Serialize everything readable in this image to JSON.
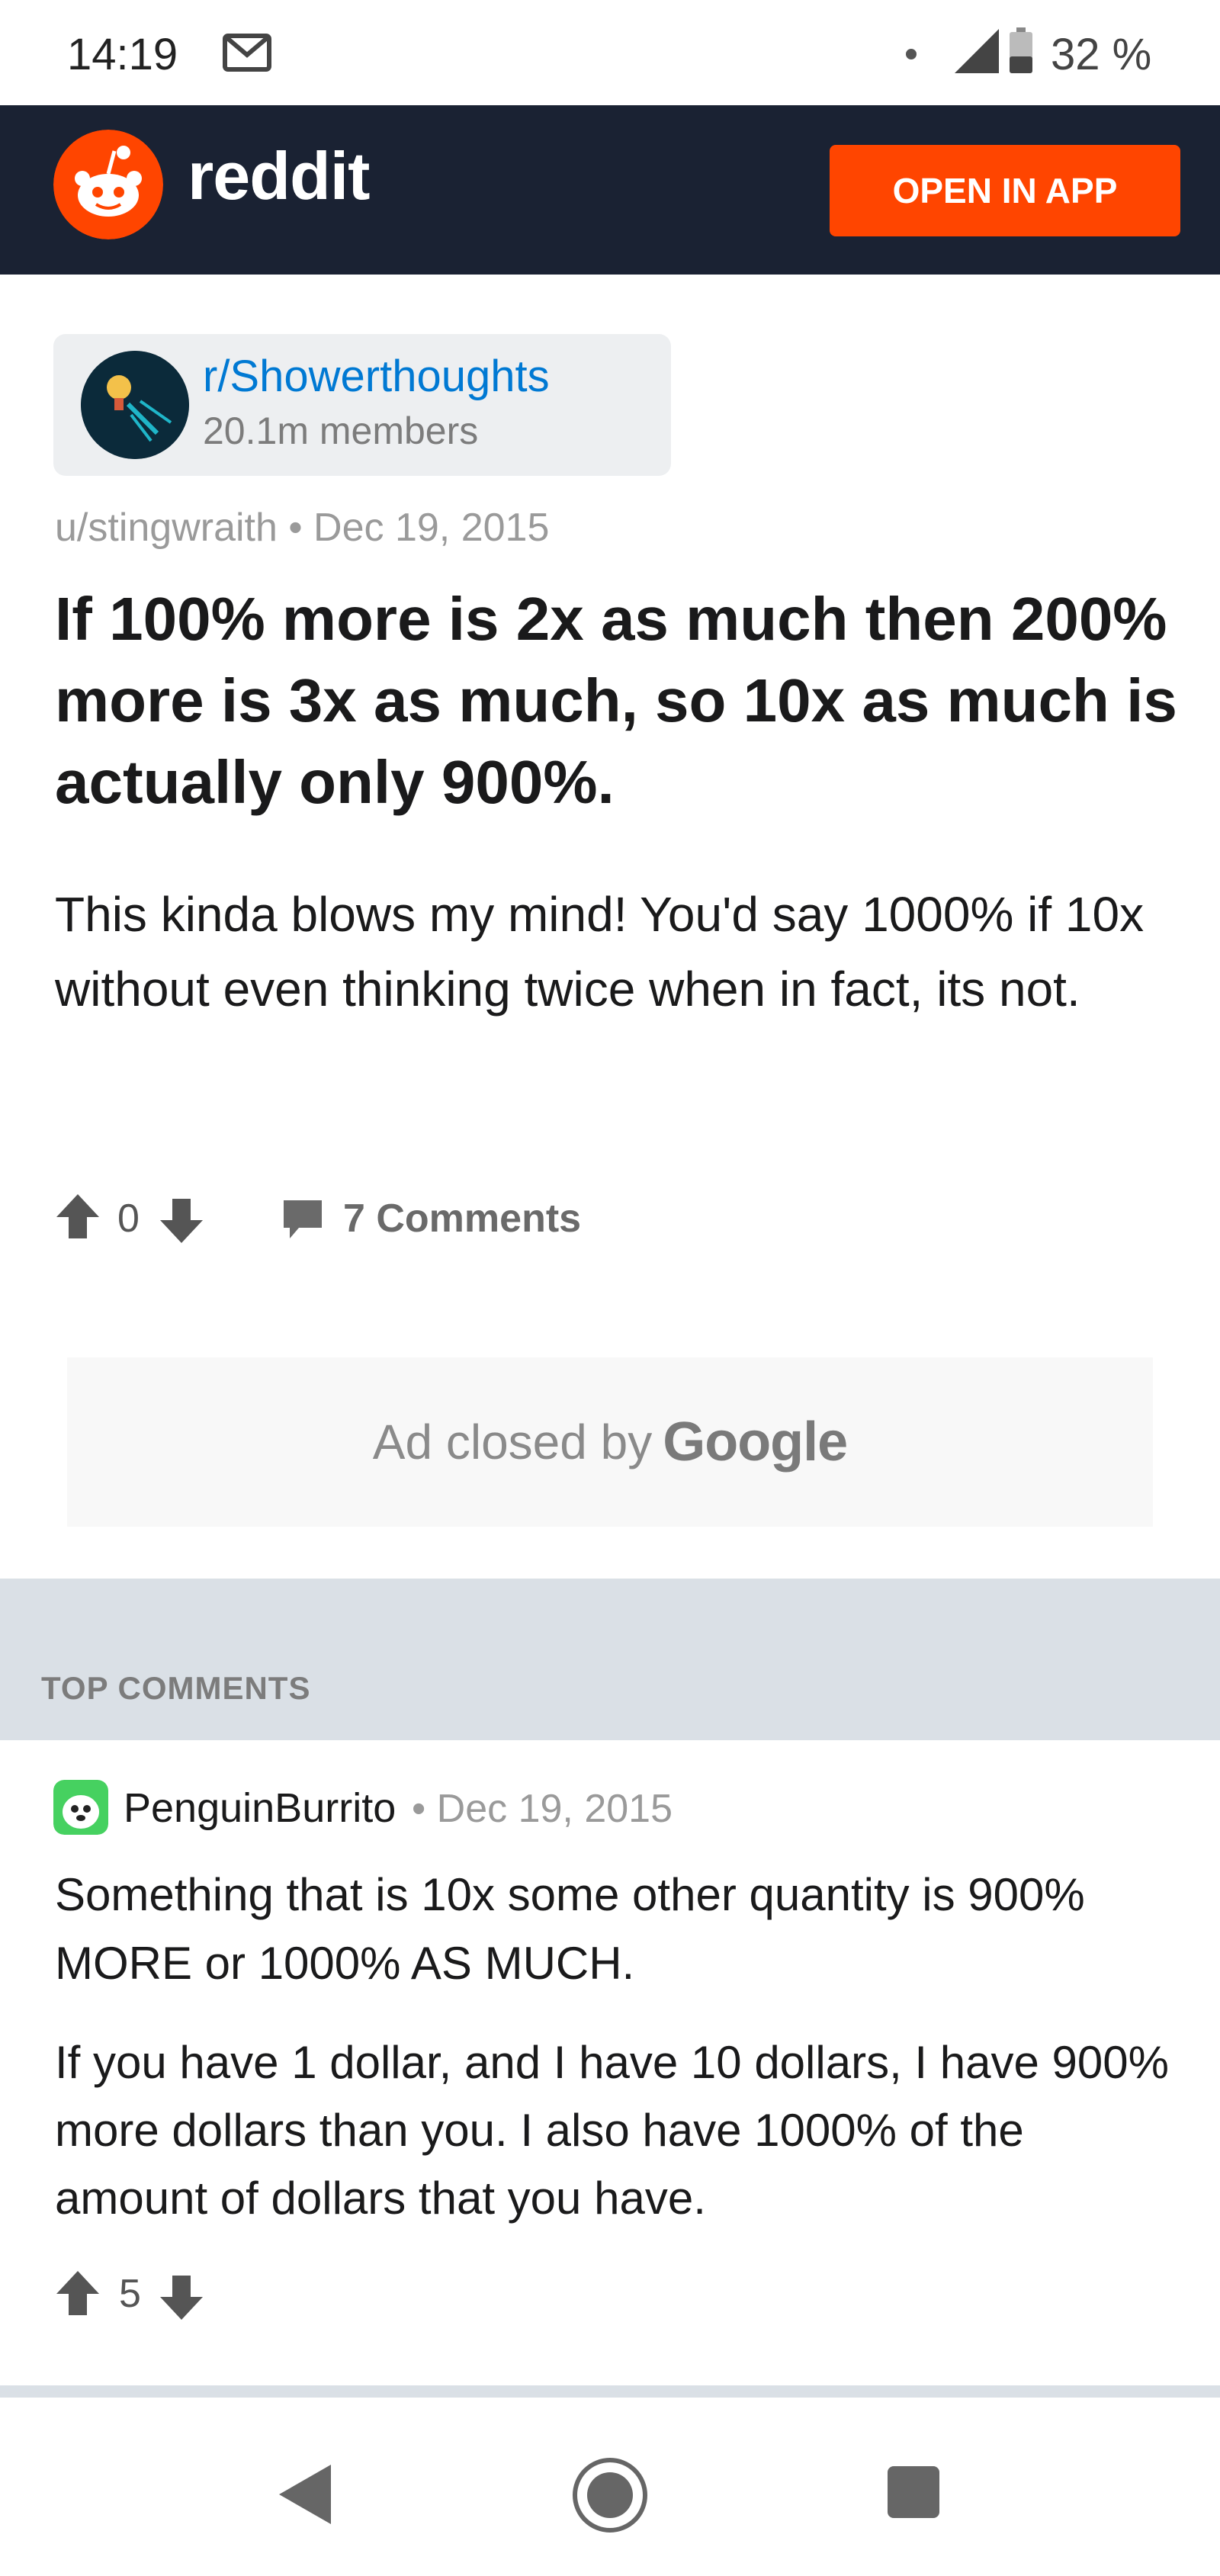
{
  "status_bar": {
    "time": "14:19",
    "battery_pct": "32 %",
    "icons": [
      "gmail-icon",
      "dot-icon",
      "signal-icon",
      "battery-icon"
    ]
  },
  "header": {
    "logo_text": "reddit",
    "open_in_app": "OPEN IN APP",
    "colors": {
      "bg": "#1a2233",
      "accent": "#ff4500"
    }
  },
  "subreddit": {
    "name": "r/Showerthoughts",
    "members": "20.1m members"
  },
  "post": {
    "author": "u/stingwraith",
    "separator": "•",
    "date": "Dec 19, 2015",
    "title": "If 100% more is 2x as much then 200% more is 3x as much, so 10x as much is actually only 900%.",
    "body": "This kinda blows my mind! You'd say 1000% if 10x without even thinking twice when in fact, its not.",
    "votes": "0",
    "comments": "7 Comments"
  },
  "ad": {
    "text": "Ad closed by",
    "brand": "Google"
  },
  "top_comments": {
    "label": "TOP COMMENTS"
  },
  "comment": {
    "author": "PenguinBurrito",
    "separator": "•",
    "date": "Dec 19, 2015",
    "paragraphs": [
      "Something that is 10x some other quantity is 900% MORE or 1000% AS MUCH.",
      "If you have 1 dollar, and I have 10 dollars, I have 900% more dollars than you. I also have 1000% of the amount of dollars that you have."
    ],
    "votes": "5"
  },
  "nav": {
    "icons": [
      "back-icon",
      "home-icon",
      "recents-icon"
    ]
  }
}
